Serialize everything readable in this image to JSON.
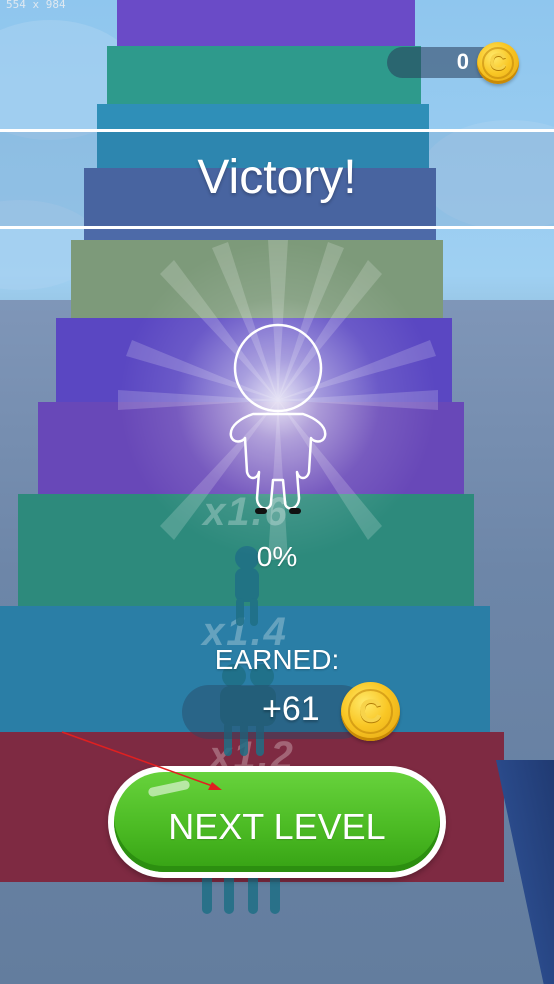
{
  "status_bar": {
    "dimensions": "554 x 984"
  },
  "hud": {
    "coins": "0",
    "coin_icon": "coin-icon"
  },
  "victory": {
    "title": "Victory!"
  },
  "result": {
    "progress_percent": "0%",
    "earned_label": "EARNED:",
    "earned_value": "+61"
  },
  "stairs": {
    "multipliers": [
      "x1.6",
      "x1.4",
      "x1.2"
    ]
  },
  "actions": {
    "next_level_label": "NEXT LEVEL"
  },
  "colors": {
    "button_green": "#4cbb24",
    "coin_gold": "#f9c624",
    "step_purple": "#6a4bc7",
    "step_teal": "#2e9a8c",
    "step_blue": "#2f8fb8",
    "step_maroon": "#8a2c45"
  }
}
